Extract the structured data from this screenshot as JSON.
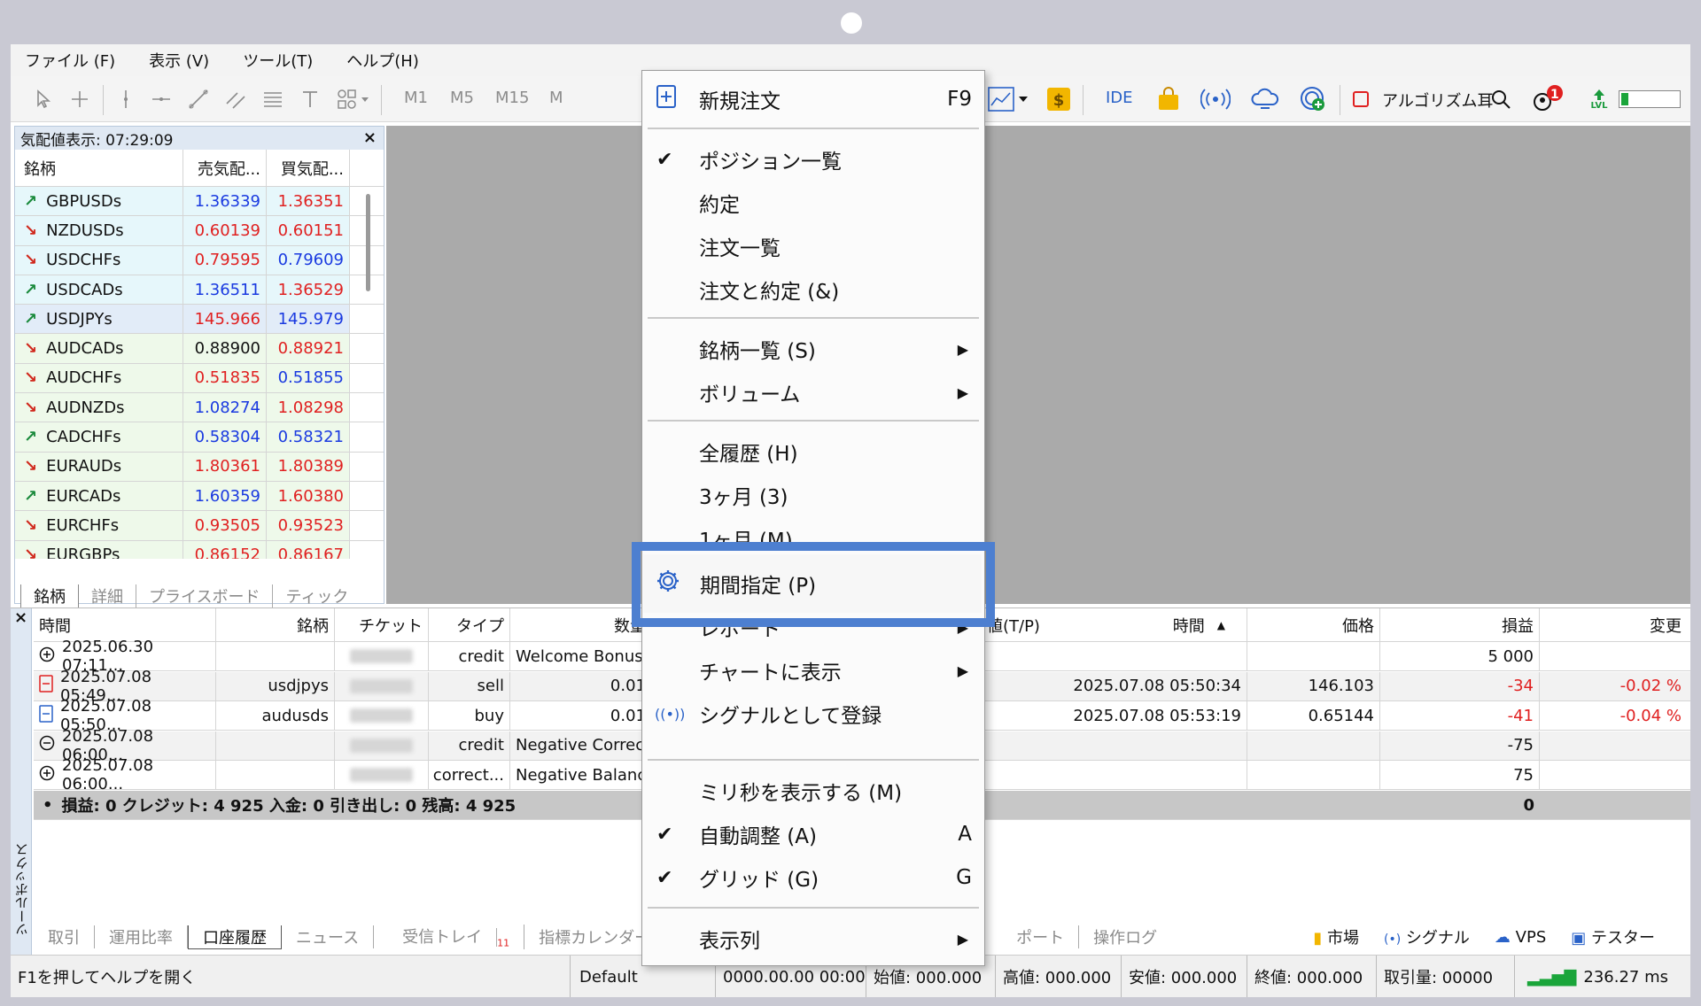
{
  "menubar": {
    "items": [
      "ファイル (F)",
      "表示 (V)",
      "ツール(T)",
      "ヘルプ(H)"
    ]
  },
  "toolbar": {
    "timeframes": [
      "M1",
      "M5",
      "M15",
      "M"
    ],
    "ide_label": "IDE",
    "algo_label": "アルゴリズム耳",
    "notification_count": "1",
    "lvl_label": "LVL"
  },
  "market_watch": {
    "title": "気配値表示: 07:29:09",
    "columns": [
      "銘柄",
      "売気配...",
      "買気配..."
    ],
    "rows": [
      {
        "dir": "up",
        "symbol": "GBPUSDs",
        "bid": "1.36339",
        "ask": "1.36351",
        "bid_color": "blue",
        "ask_color": "red"
      },
      {
        "dir": "down",
        "symbol": "NZDUSDs",
        "bid": "0.60139",
        "ask": "0.60151",
        "bid_color": "red",
        "ask_color": "red"
      },
      {
        "dir": "down",
        "symbol": "USDCHFs",
        "bid": "0.79595",
        "ask": "0.79609",
        "bid_color": "red",
        "ask_color": "blue"
      },
      {
        "dir": "up",
        "symbol": "USDCADs",
        "bid": "1.36511",
        "ask": "1.36529",
        "bid_color": "blue",
        "ask_color": "red"
      },
      {
        "dir": "up",
        "symbol": "USDJPYs",
        "bid": "145.966",
        "ask": "145.979",
        "bid_color": "red",
        "ask_color": "blue"
      },
      {
        "dir": "down",
        "symbol": "AUDCADs",
        "bid": "0.88900",
        "ask": "0.88921",
        "bid_color": "black",
        "ask_color": "red"
      },
      {
        "dir": "down",
        "symbol": "AUDCHFs",
        "bid": "0.51835",
        "ask": "0.51855",
        "bid_color": "red",
        "ask_color": "blue"
      },
      {
        "dir": "down",
        "symbol": "AUDNZDs",
        "bid": "1.08274",
        "ask": "1.08298",
        "bid_color": "blue",
        "ask_color": "red"
      },
      {
        "dir": "up",
        "symbol": "CADCHFs",
        "bid": "0.58304",
        "ask": "0.58321",
        "bid_color": "blue",
        "ask_color": "blue"
      },
      {
        "dir": "down",
        "symbol": "EURAUDs",
        "bid": "1.80361",
        "ask": "1.80389",
        "bid_color": "red",
        "ask_color": "red"
      },
      {
        "dir": "up",
        "symbol": "EURCADs",
        "bid": "1.60359",
        "ask": "1.60380",
        "bid_color": "blue",
        "ask_color": "red"
      },
      {
        "dir": "down",
        "symbol": "EURCHFs",
        "bid": "0.93505",
        "ask": "0.93523",
        "bid_color": "red",
        "ask_color": "red"
      },
      {
        "dir": "down",
        "symbol": "EURGBPs",
        "bid": "0.86152",
        "ask": "0.86167",
        "bid_color": "red",
        "ask_color": "red"
      }
    ],
    "tabs": [
      "銘柄",
      "詳細",
      "プライスボード",
      "ティック"
    ]
  },
  "history": {
    "columns": {
      "time": "時間",
      "symbol": "銘柄",
      "ticket": "チケット",
      "type": "タイプ",
      "volume": "数量",
      "tp": "値(T/P)",
      "close_time": "時間",
      "price": "価格",
      "profit": "損益",
      "change": "変更"
    },
    "rows": [
      {
        "icon": "plus",
        "time": "2025.06.30 07:11...",
        "symbol": "",
        "ticket": "29073197",
        "type": "credit",
        "volume": "Welcome Bonus",
        "close_time": "",
        "price": "",
        "profit": "5 000",
        "change": ""
      },
      {
        "icon": "sell",
        "time": "2025.07.08 05:49...",
        "symbol": "usdjpys",
        "ticket": "16686389",
        "type": "sell",
        "volume": "0.01",
        "close_time": "2025.07.08 05:50:34",
        "price": "146.103",
        "profit": "-34",
        "change": "-0.02 %"
      },
      {
        "icon": "buy",
        "time": "2025.07.08 05:50...",
        "symbol": "audusds",
        "ticket": "16686440",
        "type": "buy",
        "volume": "0.01",
        "close_time": "2025.07.08 05:53:19",
        "price": "0.65144",
        "profit": "-41",
        "change": "-0.04 %"
      },
      {
        "icon": "minus",
        "time": "2025.07.08 06:00...",
        "symbol": "",
        "ticket": "30412071",
        "type": "credit",
        "volume": "Negative Correct",
        "close_time": "",
        "price": "",
        "profit": "-75",
        "change": ""
      },
      {
        "icon": "plus",
        "time": "2025.07.08 06:00...",
        "symbol": "",
        "ticket": "30412072",
        "type": "correct...",
        "volume": "Negative Balance",
        "close_time": "",
        "price": "",
        "profit": "75",
        "change": ""
      }
    ],
    "total": {
      "text": "損益: 0  クレジット: 4 925  入金: 0  引き出し: 0  残高: 4 925",
      "profit": "0"
    }
  },
  "toolbox": {
    "side_label": "ツールボックス",
    "tabs": [
      "取引",
      "運用比率",
      "口座履歴",
      "ニュース",
      "受信トレイ",
      "指標カレンダー"
    ],
    "inbox_count": "11",
    "tabs_right": [
      "ポート",
      "操作ログ"
    ],
    "right_items": [
      "市場",
      "シグナル",
      "VPS",
      "テスター"
    ]
  },
  "status_bar": {
    "help": "F1を押してヘルプを開く",
    "profile": "Default",
    "datetime": "0000.00.00 00:00",
    "open": "始値: 000.000",
    "high": "高値: 000.000",
    "low": "安値: 000.000",
    "close": "終値: 000.000",
    "volume": "取引量: 00000",
    "ping": "236.27 ms"
  },
  "context_menu": {
    "new_order": "新規注文",
    "new_order_shortcut": "F9",
    "positions": "ポジション一覧",
    "deals": "約定",
    "orders": "注文一覧",
    "orders_deals": "注文と約定 (&)",
    "symbols": "銘柄一覧 (S)",
    "volume": "ボリューム",
    "all_history": "全履歴 (H)",
    "three_months": "3ヶ月 (3)",
    "one_month": "1ヶ月 (M)",
    "custom_period": "期間指定 (P)",
    "report": "レポート",
    "show_on_chart": "チャートに表示",
    "register_signal": "シグナルとして登録",
    "show_ms": "ミリ秒を表示する (M)",
    "auto_arrange": "自動調整 (A)",
    "auto_arrange_shortcut": "A",
    "grid": "グリッド (G)",
    "grid_shortcut": "G",
    "columns": "表示列"
  },
  "colors": {
    "highlight": "#4d7fd0",
    "up": "#1a8a3c",
    "down": "#d0281c",
    "blue": "#1a3ae0",
    "red": "#e02020"
  }
}
